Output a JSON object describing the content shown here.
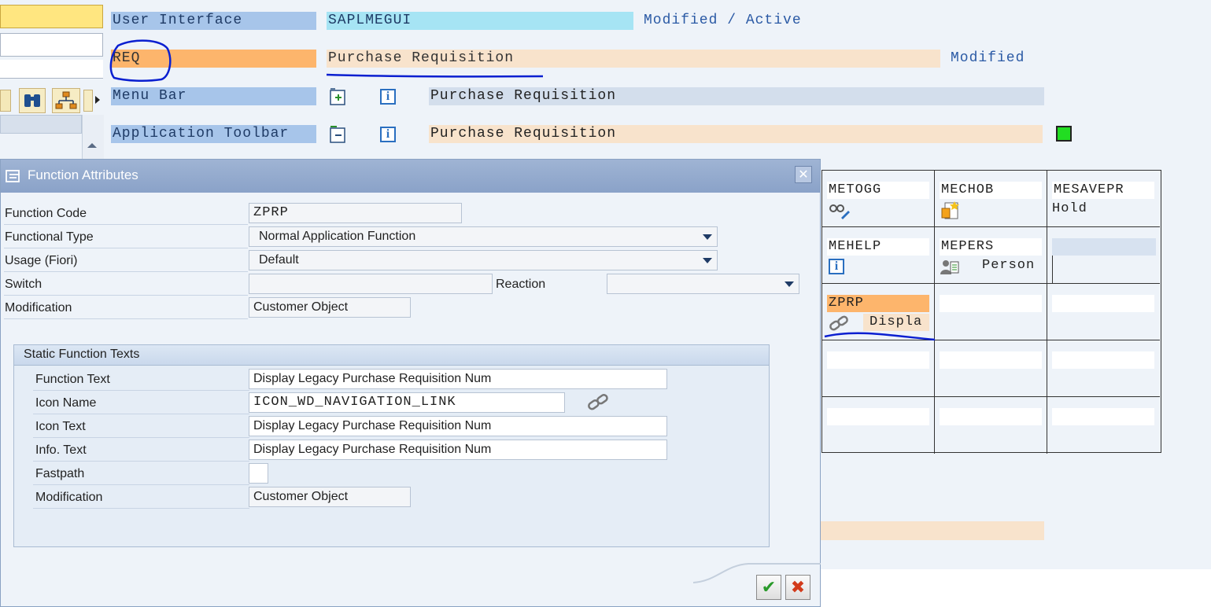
{
  "header": {
    "row1": {
      "label": "User Interface",
      "value": "SAPLMEGUI",
      "status": "Modified / Active"
    },
    "row2": {
      "label": "REQ",
      "value": "Purchase Requisition",
      "status": "Modified"
    },
    "row3": {
      "label": "Menu Bar",
      "value": "Purchase Requisition"
    },
    "row4": {
      "label": "Application Toolbar",
      "value": "Purchase Requisition"
    }
  },
  "grid": {
    "cells": [
      {
        "code": "METOGG",
        "sub": "",
        "icon": "glasses-edit-icon"
      },
      {
        "code": "MECHOB",
        "sub": "",
        "icon": "document-change-icon"
      },
      {
        "code": "MESAVEPR",
        "sub": "Hold",
        "icon": ""
      },
      {
        "code": "MEHELP",
        "sub": "",
        "icon": "info-icon"
      },
      {
        "code": "MEPERS",
        "sub": "Person",
        "icon": "personalize-icon"
      },
      {
        "code": "",
        "sub": "",
        "icon": ""
      },
      {
        "code": "ZPRP",
        "sub": "Displa",
        "icon": "link-icon"
      }
    ]
  },
  "dialog": {
    "title": "Function Attributes",
    "fields": {
      "function_code": {
        "label": "Function Code",
        "value": "ZPRP"
      },
      "functional_type": {
        "label": "Functional Type",
        "value": "Normal Application Function"
      },
      "usage": {
        "label": "Usage (Fiori)",
        "value": "Default"
      },
      "switch": {
        "label": "Switch",
        "value": ""
      },
      "reaction": {
        "label": "Reaction",
        "value": ""
      },
      "modification": {
        "label": "Modification",
        "value": "Customer Object"
      }
    },
    "group": {
      "title": "Static Function Texts",
      "function_text": {
        "label": "Function Text",
        "value": "Display Legacy Purchase Requisition Num"
      },
      "icon_name": {
        "label": "Icon Name",
        "value": "ICON_WD_NAVIGATION_LINK"
      },
      "icon_text": {
        "label": "Icon Text",
        "value": "Display Legacy Purchase Requisition Num"
      },
      "info_text": {
        "label": "Info. Text",
        "value": "Display Legacy Purchase Requisition Num"
      },
      "fastpath": {
        "label": "Fastpath",
        "value": ""
      },
      "modification": {
        "label": "Modification",
        "value": "Customer Object"
      }
    }
  },
  "colors": {
    "accent_blue": "#a7c5ea",
    "peach": "#f8e3cc",
    "orange": "#fdb56c",
    "cyan": "#a6e4f4",
    "green_status": "#22dd22",
    "annotation": "#0a1fd0"
  }
}
